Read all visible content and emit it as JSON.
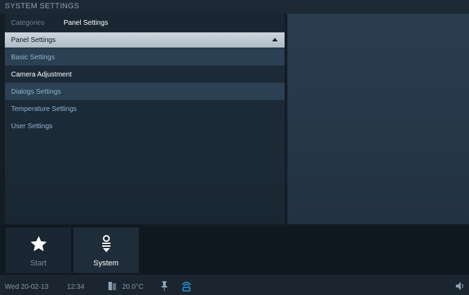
{
  "app": {
    "title": "SYSTEM SETTINGS"
  },
  "breadcrumb": {
    "parent": "Categories",
    "current": "Panel Settings"
  },
  "panel": {
    "header": "Panel Settings",
    "items": [
      {
        "label": "Basic Settings"
      },
      {
        "label": "Camera Adjustment"
      },
      {
        "label": "Dialogs Settings"
      },
      {
        "label": "Temperature Settings"
      },
      {
        "label": "User Settings"
      }
    ]
  },
  "dock": {
    "start_label": "Start",
    "system_label": "System"
  },
  "status": {
    "date": "Wed 20-02-13",
    "time": "12:34",
    "temperature": "20.0°C"
  },
  "icons": {
    "panel_caret": "caret-up-icon",
    "start": "star-icon",
    "system": "system-icon",
    "temp": "thermometer-icon",
    "pin": "pin-icon",
    "network": "network-icon",
    "volume": "speaker-icon"
  }
}
